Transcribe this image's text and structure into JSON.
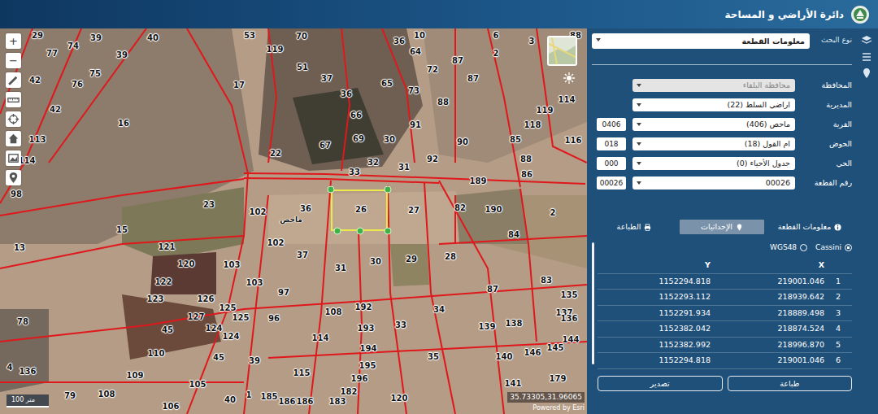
{
  "header": {
    "title": "دائرة الأراضي و المساحة"
  },
  "map": {
    "zoom_in": "+",
    "zoom_out": "−",
    "place_label": "ماحص",
    "scale": "100 متر",
    "coordinates": "35.73305,31.96065",
    "attribution": "Powered by Esri",
    "parcels": [
      {
        "label": "29",
        "selected": false
      },
      {
        "label": "39",
        "selected": false
      },
      {
        "label": "40",
        "selected": false
      },
      {
        "label": "53",
        "selected": false
      },
      {
        "label": "70",
        "selected": false
      },
      {
        "label": "36",
        "selected": false
      },
      {
        "label": "10",
        "selected": false
      },
      {
        "label": "6",
        "selected": false
      },
      {
        "label": "3",
        "selected": false
      },
      {
        "label": "88",
        "selected": false
      },
      {
        "label": "77",
        "selected": false
      },
      {
        "label": "74",
        "selected": false
      },
      {
        "label": "39",
        "selected": false
      },
      {
        "label": "119",
        "selected": false
      },
      {
        "label": "51",
        "selected": false
      },
      {
        "label": "64",
        "selected": false
      },
      {
        "label": "87",
        "selected": false
      },
      {
        "label": "2",
        "selected": false
      },
      {
        "label": "42",
        "selected": false
      },
      {
        "label": "75",
        "selected": false
      },
      {
        "label": "76",
        "selected": false
      },
      {
        "label": "17",
        "selected": false
      },
      {
        "label": "37",
        "selected": false
      },
      {
        "label": "72",
        "selected": false
      },
      {
        "label": "65",
        "selected": false
      },
      {
        "label": "87",
        "selected": false
      },
      {
        "label": "42",
        "selected": false
      },
      {
        "label": "16",
        "selected": false
      },
      {
        "label": "36",
        "selected": false
      },
      {
        "label": "73",
        "selected": false
      },
      {
        "label": "88",
        "selected": false
      },
      {
        "label": "114",
        "selected": false
      },
      {
        "label": "119",
        "selected": false
      },
      {
        "label": "66",
        "selected": false
      },
      {
        "label": "91",
        "selected": false
      },
      {
        "label": "118",
        "selected": false
      },
      {
        "label": "113",
        "selected": false
      },
      {
        "label": "67",
        "selected": false
      },
      {
        "label": "69",
        "selected": false
      },
      {
        "label": "30",
        "selected": false
      },
      {
        "label": "90",
        "selected": false
      },
      {
        "label": "85",
        "selected": false
      },
      {
        "label": "116",
        "selected": false
      },
      {
        "label": "22",
        "selected": false
      },
      {
        "label": "92",
        "selected": false
      },
      {
        "label": "114",
        "selected": false
      },
      {
        "label": "88",
        "selected": false
      },
      {
        "label": "33",
        "selected": false
      },
      {
        "label": "32",
        "selected": false
      },
      {
        "label": "31",
        "selected": false
      },
      {
        "label": "86",
        "selected": false
      },
      {
        "label": "189",
        "selected": false
      },
      {
        "label": "98",
        "selected": false
      },
      {
        "label": "23",
        "selected": false
      },
      {
        "label": "36",
        "selected": false
      },
      {
        "label": "26",
        "selected": true
      },
      {
        "label": "27",
        "selected": false
      },
      {
        "label": "102",
        "selected": false
      },
      {
        "label": "82",
        "selected": false
      },
      {
        "label": "190",
        "selected": false
      },
      {
        "label": "2",
        "selected": false
      },
      {
        "label": "15",
        "selected": false
      },
      {
        "label": "84",
        "selected": false
      },
      {
        "label": "13",
        "selected": false
      },
      {
        "label": "121",
        "selected": false
      },
      {
        "label": "102",
        "selected": false
      },
      {
        "label": "37",
        "selected": false
      },
      {
        "label": "31",
        "selected": false
      },
      {
        "label": "30",
        "selected": false
      },
      {
        "label": "29",
        "selected": false
      },
      {
        "label": "28",
        "selected": false
      },
      {
        "label": "120",
        "selected": false
      },
      {
        "label": "103",
        "selected": false
      },
      {
        "label": "122",
        "selected": false
      },
      {
        "label": "103",
        "selected": false
      },
      {
        "label": "97",
        "selected": false
      },
      {
        "label": "87",
        "selected": false
      },
      {
        "label": "123",
        "selected": false
      },
      {
        "label": "126",
        "selected": false
      },
      {
        "label": "83",
        "selected": false
      },
      {
        "label": "135",
        "selected": false
      },
      {
        "label": "125",
        "selected": false
      },
      {
        "label": "108",
        "selected": false
      },
      {
        "label": "192",
        "selected": false
      },
      {
        "label": "34",
        "selected": false
      },
      {
        "label": "137",
        "selected": false
      },
      {
        "label": "78",
        "selected": false
      },
      {
        "label": "45",
        "selected": false
      },
      {
        "label": "127",
        "selected": false
      },
      {
        "label": "125",
        "selected": false
      },
      {
        "label": "96",
        "selected": false
      },
      {
        "label": "136",
        "selected": false
      },
      {
        "label": "124",
        "selected": false
      },
      {
        "label": "124",
        "selected": false
      },
      {
        "label": "114",
        "selected": false
      },
      {
        "label": "193",
        "selected": false
      },
      {
        "label": "33",
        "selected": false
      },
      {
        "label": "139",
        "selected": false
      },
      {
        "label": "138",
        "selected": false
      },
      {
        "label": "144",
        "selected": false
      },
      {
        "label": "110",
        "selected": false
      },
      {
        "label": "45",
        "selected": false
      },
      {
        "label": "39",
        "selected": false
      },
      {
        "label": "194",
        "selected": false
      },
      {
        "label": "35",
        "selected": false
      },
      {
        "label": "140",
        "selected": false
      },
      {
        "label": "146",
        "selected": false
      },
      {
        "label": "145",
        "selected": false
      },
      {
        "label": "136",
        "selected": false
      },
      {
        "label": "4",
        "selected": false
      },
      {
        "label": "109",
        "selected": false
      },
      {
        "label": "115",
        "selected": false
      },
      {
        "label": "195",
        "selected": false
      },
      {
        "label": "196",
        "selected": false
      },
      {
        "label": "179",
        "selected": false
      },
      {
        "label": "141",
        "selected": false
      },
      {
        "label": "105",
        "selected": false
      },
      {
        "label": "182",
        "selected": false
      },
      {
        "label": "120",
        "selected": false
      },
      {
        "label": "108",
        "selected": false
      },
      {
        "label": "79",
        "selected": false
      },
      {
        "label": "40",
        "selected": false
      },
      {
        "label": "1",
        "selected": false
      },
      {
        "label": "185",
        "selected": false
      },
      {
        "label": "186",
        "selected": false
      },
      {
        "label": "183",
        "selected": false
      },
      {
        "label": "186",
        "selected": false
      },
      {
        "label": "106",
        "selected": false
      }
    ]
  },
  "panel": {
    "search": {
      "label": "نوع البحث",
      "value": "معلومات القطعة"
    },
    "fields": [
      {
        "kind": "plain",
        "label": "المحافظة",
        "value": "محافظة البلقاء",
        "disabled": true
      },
      {
        "kind": "plain",
        "label": "المديرية",
        "value": "اراضي السلط (22)",
        "disabled": false
      },
      {
        "kind": "coded",
        "label": "القرية",
        "value": "ماحص (406)",
        "code": "0406",
        "disabled": false
      },
      {
        "kind": "coded",
        "label": "الحوض",
        "value": "ام القول (18)",
        "code": "018",
        "disabled": false
      },
      {
        "kind": "coded",
        "label": "الحي",
        "value": "جدول الأحياء (0)",
        "code": "000",
        "disabled": false
      },
      {
        "kind": "coded",
        "label": "رقم القطعة",
        "value": "00026",
        "code": "00026",
        "disabled": false
      }
    ],
    "tabs": [
      {
        "label": "معلومات القطعة",
        "selected": false
      },
      {
        "label": "الإحداثيات",
        "selected": true
      },
      {
        "label": "الطباعة",
        "selected": false
      }
    ],
    "crs_options": [
      {
        "label": "Cassini",
        "selected": true
      },
      {
        "label": "WGS48",
        "selected": false
      }
    ],
    "table": {
      "columns": [
        "X",
        "Y"
      ],
      "rows": [
        {
          "index": "1",
          "x": "219001.046",
          "y": "1152294.818"
        },
        {
          "index": "2",
          "x": "218939.642",
          "y": "1152293.112"
        },
        {
          "index": "3",
          "x": "218889.498",
          "y": "1152291.934"
        },
        {
          "index": "4",
          "x": "218874.524",
          "y": "1152382.042"
        },
        {
          "index": "5",
          "x": "218996.870",
          "y": "1152382.992"
        },
        {
          "index": "6",
          "x": "219001.046",
          "y": "1152294.818"
        }
      ]
    },
    "buttons": [
      "طباعة",
      "تصدير"
    ]
  }
}
